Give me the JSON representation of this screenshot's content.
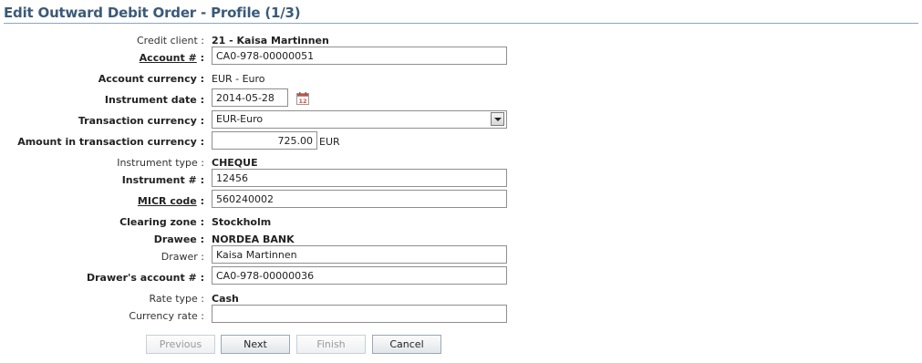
{
  "page": {
    "title": "Edit Outward Debit Order - Profile (1/3)"
  },
  "form": {
    "credit_client": {
      "label": "Credit client :",
      "value": "21 - Kaisa Martinnen"
    },
    "account_no": {
      "label": "Account #",
      "value": "CA0-978-00000051",
      "colon": ":"
    },
    "account_currency": {
      "label": "Account currency :",
      "value": "EUR - Euro"
    },
    "instrument_date": {
      "label": "Instrument date :",
      "value": "2014-05-28",
      "icon": "calendar-icon"
    },
    "transaction_currency": {
      "label": "Transaction currency :",
      "value": "EUR-Euro"
    },
    "amount": {
      "label": "Amount in transaction currency :",
      "value": "725.00",
      "unit": "EUR"
    },
    "instrument_type": {
      "label": "Instrument type :",
      "value": "CHEQUE"
    },
    "instrument_no": {
      "label": "Instrument # :",
      "value": "12456"
    },
    "micr_code": {
      "label": "MICR code",
      "value": "560240002",
      "colon": ":"
    },
    "clearing_zone": {
      "label": "Clearing zone :",
      "value": "Stockholm"
    },
    "drawee": {
      "label": "Drawee :",
      "value": "NORDEA BANK"
    },
    "drawer": {
      "label": "Drawer :",
      "value": "Kaisa Martinnen"
    },
    "drawer_account": {
      "label": "Drawer's account # :",
      "value": "CA0-978-00000036"
    },
    "rate_type": {
      "label": "Rate type :",
      "value": "Cash"
    },
    "currency_rate": {
      "label": "Currency rate :",
      "value": ""
    }
  },
  "buttons": {
    "previous": "Previous",
    "next": "Next",
    "finish": "Finish",
    "cancel": "Cancel"
  },
  "colors": {
    "title": "#3a5a7a",
    "rule": "#8aa6c0"
  }
}
